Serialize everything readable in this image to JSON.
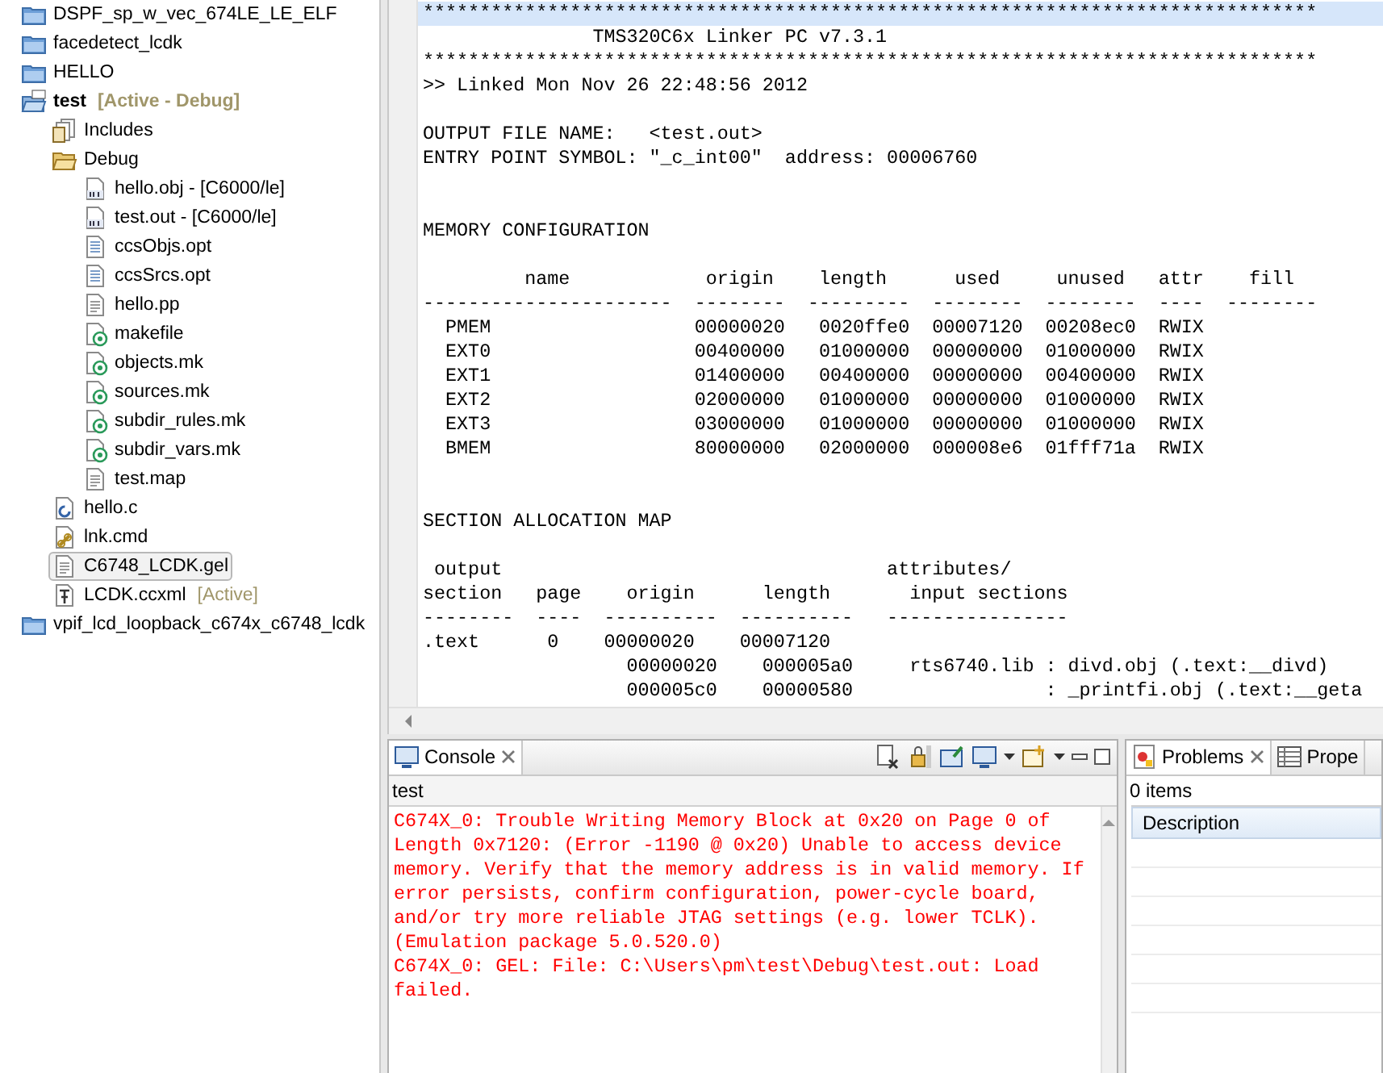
{
  "project_tree": [
    {
      "label": "DSPF_sp_w_vec_674LE_LE_ELF",
      "kind": "project-folder",
      "selected": false
    },
    {
      "label": "facedetect_lcdk",
      "kind": "project-folder",
      "selected": false
    },
    {
      "label": "HELLO",
      "kind": "project-folder",
      "selected": false
    },
    {
      "label": "test",
      "suffix": "[Active - Debug]",
      "kind": "ccs-project",
      "selected": false,
      "children": [
        {
          "label": "Includes",
          "kind": "includes",
          "selected": false
        },
        {
          "label": "Debug",
          "kind": "folder",
          "selected": false,
          "children": [
            {
              "label": "hello.obj - [C6000/le]",
              "kind": "binary",
              "selected": false
            },
            {
              "label": "test.out - [C6000/le]",
              "kind": "binary",
              "selected": false
            },
            {
              "label": "ccsObjs.opt",
              "kind": "options-file",
              "selected": false
            },
            {
              "label": "ccsSrcs.opt",
              "kind": "options-file",
              "selected": false
            },
            {
              "label": "hello.pp",
              "kind": "text-file",
              "selected": false
            },
            {
              "label": "makefile",
              "kind": "makefile",
              "selected": false
            },
            {
              "label": "objects.mk",
              "kind": "makefile",
              "selected": false
            },
            {
              "label": "sources.mk",
              "kind": "makefile",
              "selected": false
            },
            {
              "label": "subdir_rules.mk",
              "kind": "makefile",
              "selected": false
            },
            {
              "label": "subdir_vars.mk",
              "kind": "makefile",
              "selected": false
            },
            {
              "label": "test.map",
              "kind": "text-file",
              "selected": false
            }
          ]
        },
        {
          "label": "hello.c",
          "kind": "c-file",
          "selected": false
        },
        {
          "label": "lnk.cmd",
          "kind": "linker-file",
          "selected": false
        },
        {
          "label": "C6748_LCDK.gel",
          "kind": "text-file",
          "selected": true
        },
        {
          "label": "LCDK.ccxml",
          "suffix": "[Active]",
          "kind": "target-config",
          "selected": false
        }
      ]
    },
    {
      "label": "vpif_lcd_loopback_c674x_c6748_lcdk",
      "kind": "project-folder",
      "selected": false
    }
  ],
  "editor": {
    "banner": [
      {
        "text": "*******************************************************************************",
        "current": true
      },
      {
        "text": "               TMS320C6x Linker PC v7.3.1",
        "current": false
      },
      {
        "text": "*******************************************************************************",
        "current": false
      },
      {
        "text": ">> Linked Mon Nov 26 22:48:56 2012",
        "current": false
      }
    ],
    "info": [
      "OUTPUT FILE NAME:   <test.out>",
      "ENTRY POINT SYMBOL: \"_c_int00\"  address: 00006760"
    ],
    "sections": [
      {
        "title": "MEMORY CONFIGURATION",
        "lines": [
          "         name            origin    length      used     unused   attr    fill",
          "----------------------  --------  ---------  --------  --------  ----  --------",
          "  PMEM                  00000020   0020ffe0  00007120  00208ec0  RWIX",
          "  EXT0                  00400000   01000000  00000000  01000000  RWIX",
          "  EXT1                  01400000   00400000  00000000  00400000  RWIX",
          "  EXT2                  02000000   01000000  00000000  01000000  RWIX",
          "  EXT3                  03000000   01000000  00000000  01000000  RWIX",
          "  BMEM                  80000000   02000000  000008e6  01fff71a  RWIX"
        ]
      },
      {
        "title": "SECTION ALLOCATION MAP",
        "lines": [
          " output                                  attributes/",
          "section   page    origin      length       input sections",
          "--------  ----  ----------  ----------   ----------------",
          ".text      0    00000020    00007120",
          "                  00000020    000005a0     rts6740.lib : divd.obj (.text:__divd)",
          "                  000005c0    00000580                 : _printfi.obj (.text:__geta"
        ]
      }
    ]
  },
  "console": {
    "tab": {
      "label": "Console",
      "selected": true
    },
    "source": "test",
    "messages": [
      {
        "kind": "error",
        "text": "C674X_0: Trouble Writing Memory Block at 0x20 on Page 0 of Length 0x7120: (Error -1190 @ 0x20) Unable to access device memory. Verify that the memory address is in valid memory. If error persists, confirm configuration, power-cycle board, and/or try more reliable JTAG settings (e.g. lower TCLK). (Emulation package 5.0.520.0)"
      },
      {
        "kind": "error",
        "text": "C674X_0: GEL: File: C:\\Users\\pm\\test\\Debug\\test.out: Load failed."
      }
    ]
  },
  "problems": {
    "tabs": [
      {
        "label": "Problems",
        "selected": true,
        "kind": "problems"
      },
      {
        "label": "Prope",
        "selected": false,
        "kind": "properties"
      }
    ],
    "summary": "0 items",
    "columns": [
      "Description"
    ]
  }
}
